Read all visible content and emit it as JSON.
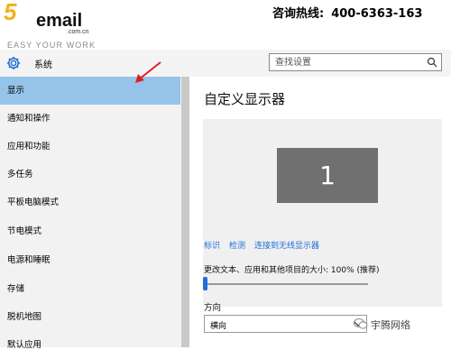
{
  "banner": {
    "logo_number": "5",
    "logo_word": "email",
    "logo_domain": ".com.cn",
    "logo_slogan": "EASY YOUR WORK",
    "hotline_label": "咨询热线:",
    "hotline_number": "400-6363-163"
  },
  "window": {
    "title": "系统",
    "search_placeholder": "查找设置"
  },
  "sidebar": {
    "items": [
      {
        "label": "显示"
      },
      {
        "label": "通知和操作"
      },
      {
        "label": "应用和功能"
      },
      {
        "label": "多任务"
      },
      {
        "label": "平板电脑模式"
      },
      {
        "label": "节电模式"
      },
      {
        "label": "电源和睡眠"
      },
      {
        "label": "存储"
      },
      {
        "label": "脱机地图"
      },
      {
        "label": "默认应用"
      }
    ]
  },
  "main": {
    "title": "自定义显示器",
    "monitor_number": "1",
    "links": [
      "标识",
      "检测",
      "连接到无线显示器"
    ],
    "scale_label": "更改文本、应用和其他项目的大小: 100% (推荐)",
    "scale_value_percent": 100,
    "orientation_label": "方向",
    "orientation_value": "横向"
  },
  "watermark": {
    "text": "宇腾网络"
  },
  "colors": {
    "active_item": "#96c3e9",
    "accent": "#1e6fd9",
    "annotation_arrow": "#e02020"
  },
  "icons": [
    "gear-icon",
    "search-icon",
    "chevron-down-icon",
    "red-arrow-annotation",
    "wechat-icon"
  ]
}
